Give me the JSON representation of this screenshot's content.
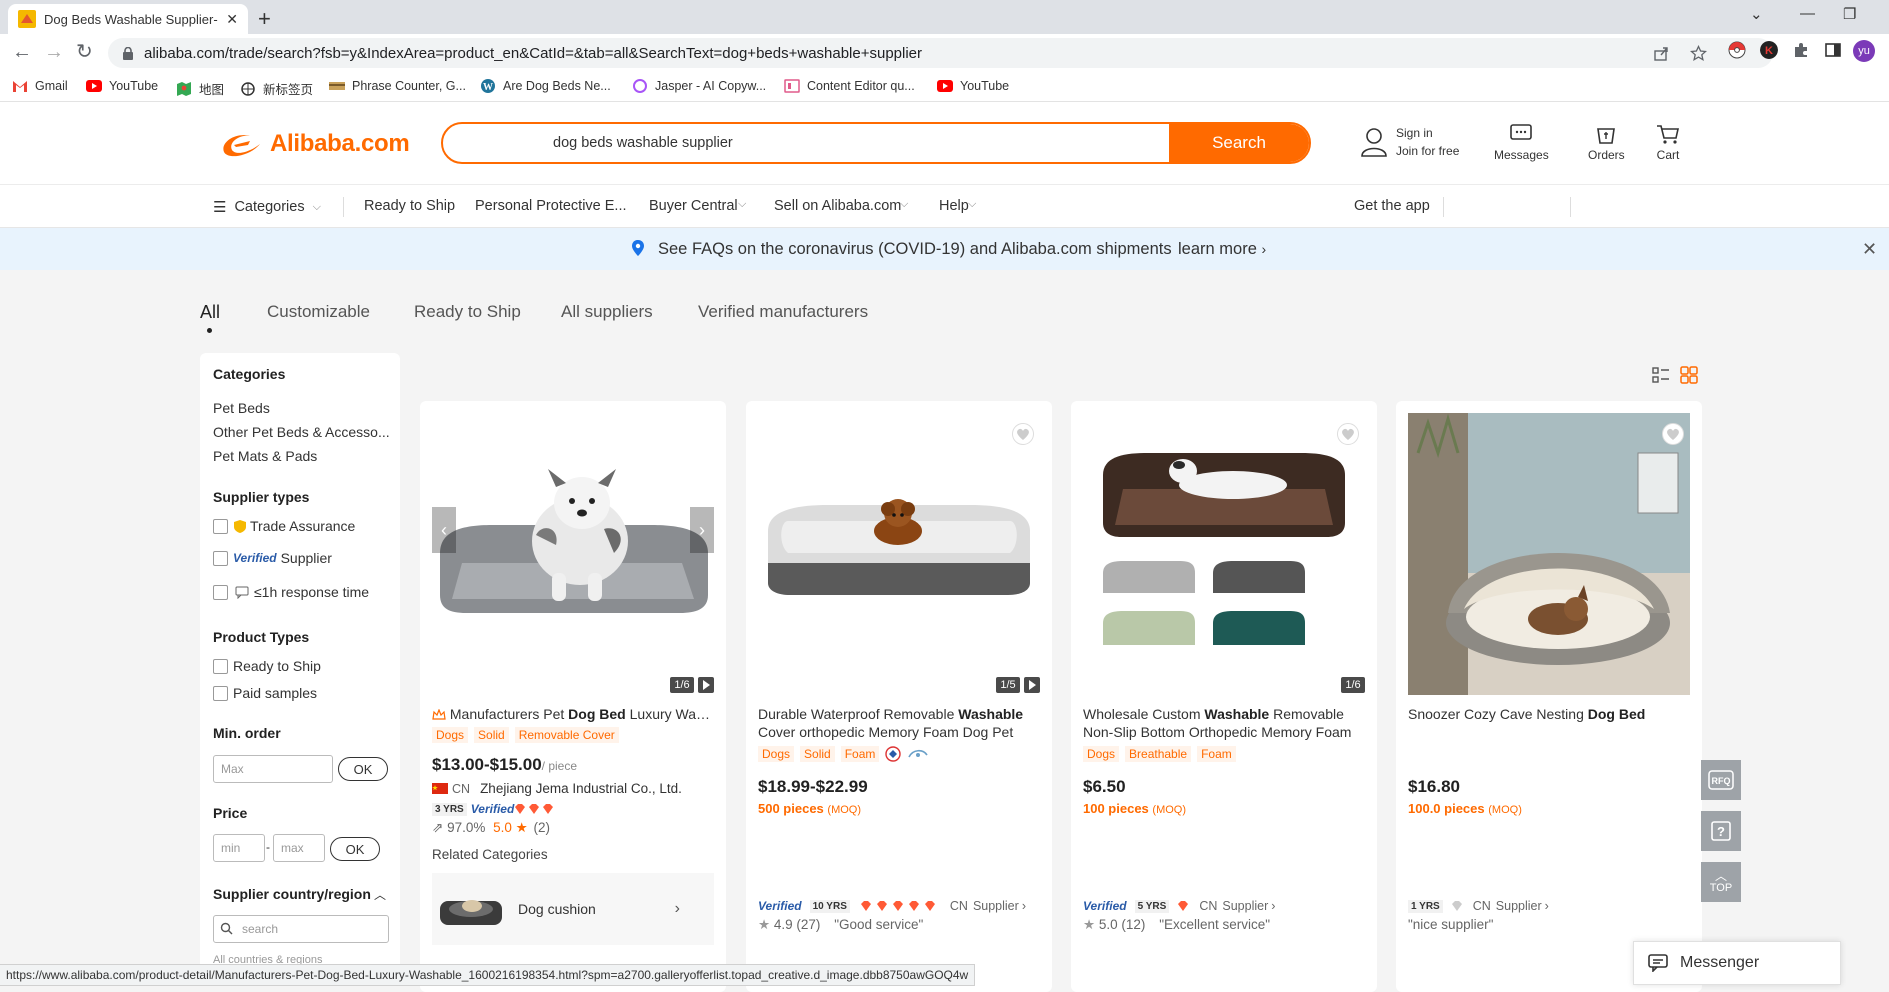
{
  "browser": {
    "tab_title": "Dog Beds Washable Supplier-",
    "url": "alibaba.com/trade/search?fsb=y&IndexArea=product_en&CatId=&tab=all&SearchText=dog+beds+washable+supplier",
    "profile_initials": "yu",
    "bookmarks": [
      "Gmail",
      "YouTube",
      "地图",
      "新标签页",
      "Phrase Counter, G...",
      "Are Dog Beds Ne...",
      "Jasper - AI Copyw...",
      "Content Editor qu...",
      "YouTube"
    ],
    "status_url": "https://www.alibaba.com/product-detail/Manufacturers-Pet-Dog-Bed-Luxury-Washable_1600216198354.html?spm=a2700.galleryofferlist.topad_creative.d_image.dbb8750awGOQ4w"
  },
  "header": {
    "logo_text": "Alibaba.com",
    "search_query": "dog beds washable supplier",
    "search_button": "Search",
    "sign_in": "Sign in",
    "join": "Join for free",
    "messages": "Messages",
    "orders": "Orders",
    "cart": "Cart"
  },
  "nav": {
    "categories": "Categories",
    "items": [
      "Ready to Ship",
      "Personal Protective E...",
      "Buyer Central",
      "Sell on Alibaba.com",
      "Help"
    ],
    "get_app": "Get the app"
  },
  "banner": {
    "message": "See FAQs on the coronavirus (COVID-19) and Alibaba.com shipments",
    "link": "learn more"
  },
  "result_tabs": [
    "All",
    "Customizable",
    "Ready to Ship",
    "All suppliers",
    "Verified manufacturers"
  ],
  "sidebar": {
    "categories_title": "Categories",
    "categories": [
      "Pet Beds",
      "Other Pet Beds & Accesso...",
      "Pet Mats & Pads"
    ],
    "supplier_types_title": "Supplier types",
    "supplier_types": [
      "Trade Assurance",
      "Verified",
      "Supplier",
      "≤1h response time"
    ],
    "product_types_title": "Product Types",
    "product_types": [
      "Ready to Ship",
      "Paid samples"
    ],
    "min_order_title": "Min. order",
    "min_order_placeholder": "Max",
    "ok": "OK",
    "price_title": "Price",
    "price_min": "min",
    "price_max": "max",
    "price_sep": "-",
    "country_title": "Supplier country/region",
    "country_search": "search",
    "all_countries": "All countries & regions"
  },
  "products": [
    {
      "title_pre": "Manufacturers Pet ",
      "title_bold": "Dog Bed",
      "title_post": " Luxury Washable",
      "tags": [
        "Dogs",
        "Solid",
        "Removable Cover"
      ],
      "price": "$13.00-$15.00",
      "unit": "/ piece",
      "counter": "1/6",
      "supplier_country": "CN",
      "supplier_name": "Zhejiang Jema Industrial Co., Ltd.",
      "years": "3 YRS",
      "verified": "Verified",
      "response": "97.0%",
      "rating": "5.0",
      "reviews": "(2)",
      "related_title": "Related Categories",
      "related_item": "Dog cushion"
    },
    {
      "title_pre": "Durable Waterproof Removable ",
      "title_bold": "Washable",
      "title_post": " Cover orthopedic Memory Foam Dog Pet",
      "tags": [
        "Dogs",
        "Solid",
        "Foam"
      ],
      "price": "$18.99-$22.99",
      "moq": "500 pieces",
      "moq_label": "(MOQ)",
      "counter": "1/5",
      "verified": "Verified",
      "years": "10 YRS",
      "supplier_country": "CN",
      "supplier_label": "Supplier",
      "rating": "4.9",
      "reviews": "(27)",
      "review_text": "\"Good service\""
    },
    {
      "title_pre": "Wholesale Custom ",
      "title_bold": "Washable",
      "title_post": " Removable Non-Slip Bottom Orthopedic Memory Foam",
      "tags": [
        "Dogs",
        "Breathable",
        "Foam"
      ],
      "price": "$6.50",
      "moq": "100 pieces",
      "moq_label": "(MOQ)",
      "counter": "1/6",
      "verified": "Verified",
      "years": "5 YRS",
      "supplier_country": "CN",
      "supplier_label": "Supplier",
      "rating": "5.0",
      "reviews": "(12)",
      "review_text": "\"Excellent service\""
    },
    {
      "title_pre": "Snoozer Cozy Cave Nesting ",
      "title_bold": "Dog Bed",
      "title_post": "",
      "price": "$16.80",
      "moq": "100.0 pieces",
      "moq_label": "(MOQ)",
      "years": "1 YRS",
      "supplier_country": "CN",
      "supplier_label": "Supplier",
      "review_text": "\"nice supplier\""
    }
  ],
  "floating": {
    "rfq": "RFQ",
    "top": "TOP",
    "messenger": "Messenger"
  },
  "colors": {
    "accent": "#ff6a00",
    "banner": "#e8f3fd",
    "verified": "#2a5ba8"
  }
}
